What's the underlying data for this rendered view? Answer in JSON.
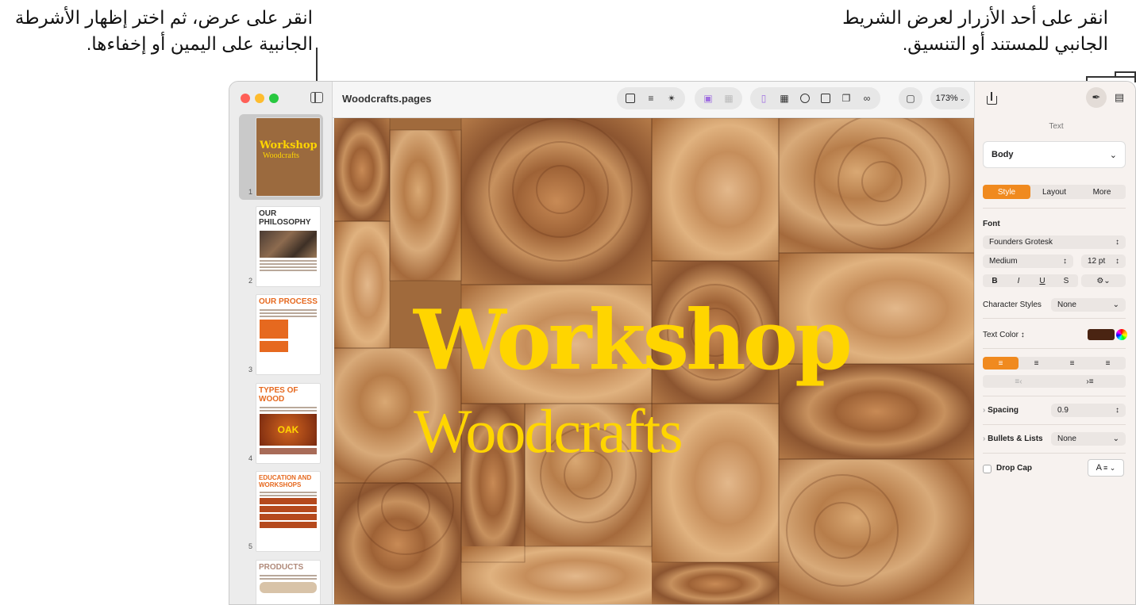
{
  "annotations": {
    "left_line1": "انقر على عرض، ثم اختر إظهار الأشرطة",
    "left_line2": "الجانبية على اليمين أو إخفاءها.",
    "right_line1": "انقر على أحد الأزرار لعرض الشريط",
    "right_line2": "الجانبي للمستند أو التنسيق."
  },
  "window": {
    "title": "Woodcrafts.pages",
    "zoom": "173%"
  },
  "toolbar_groups": [
    {
      "name": "insert",
      "icons": [
        "insert-icon",
        "list-icon",
        "shape-badge-icon"
      ]
    },
    {
      "name": "media",
      "icons": [
        "media-icon",
        "grid-icon"
      ]
    },
    {
      "name": "objects",
      "icons": [
        "text-box-icon",
        "table-icon",
        "chart-icon",
        "textbox-icon",
        "shapes-icon",
        "attachment-icon"
      ]
    }
  ],
  "thumbnails": [
    {
      "num": "1",
      "title": "Workshop Woodcrafts"
    },
    {
      "num": "2",
      "title": "OUR PHILOSOPHY"
    },
    {
      "num": "3",
      "title": "OUR PROCESS"
    },
    {
      "num": "4",
      "title": "TYPES OF WOOD",
      "tag": "OAK"
    },
    {
      "num": "5",
      "title": "EDUCATION AND WORKSHOPS"
    },
    {
      "num": "",
      "title": "PRODUCTS"
    }
  ],
  "thumb_snippets": {
    "p3": "At Workshop Woodcrafts, we believe that the sturdiness and elegance are key factors in sustainability.",
    "p4": "We focus on simple materials, and we make simple things.",
    "p5": "Measure twice, cut once, learn forever.",
    "p6": "Handcrafted in our spacious workshop with care, these beautiful, useful objects are designed to be at home in your home."
  },
  "canvas": {
    "headline": "Workshop",
    "subhead": "Woodcrafts"
  },
  "inspector": {
    "section_title": "Text",
    "paragraph_style": "Body",
    "tabs": [
      "Style",
      "Layout",
      "More"
    ],
    "font_label": "Font",
    "font_name": "Founders Grotesk",
    "font_weight": "Medium",
    "font_size": "12 pt",
    "emphasis": [
      "B",
      "I",
      "U",
      "S"
    ],
    "char_styles_label": "Character Styles",
    "char_styles_value": "None",
    "text_color_label": "Text Color",
    "text_color_value": "#4a2412",
    "spacing_label": "Spacing",
    "spacing_value": "0.9",
    "bullets_label": "Bullets & Lists",
    "bullets_value": "None",
    "dropcap_label": "Drop Cap",
    "dropcap_glyph": "A"
  },
  "colors": {
    "accent": "#f08a1f",
    "headline": "#ffd500"
  }
}
